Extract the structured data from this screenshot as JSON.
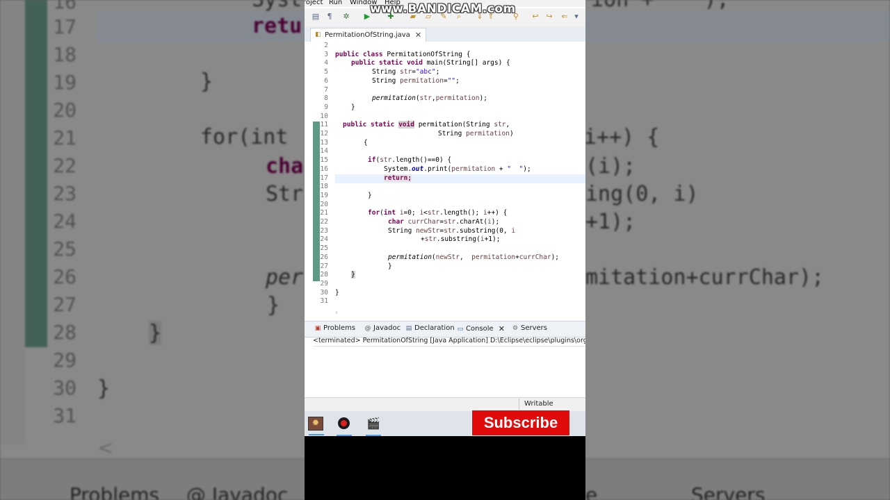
{
  "watermark": "www.BANDICAM.com",
  "menu": [
    "roject",
    "Run",
    "Window",
    "Help"
  ],
  "editor_tab": {
    "filename": "PermitationOfString.java"
  },
  "line_numbers": [
    "2",
    "3",
    "4",
    "5",
    "6",
    "7",
    "8",
    "9",
    "10",
    "11",
    "12",
    "13",
    "14",
    "15",
    "16",
    "17",
    "18",
    "19",
    "20",
    "21",
    "22",
    "23",
    "24",
    "25",
    "26",
    "27",
    "28",
    "29",
    "30",
    "31"
  ],
  "code": {
    "l3a": "public class",
    "l3b": " PermitationOfString {",
    "l4a": "public static void",
    "l4b": " main(String[] args) {",
    "l5a": "String ",
    "l5b": "str",
    "l5c": "=",
    "l5d": "\"abc\"",
    "l5e": ";",
    "l6a": "String ",
    "l6b": "permitation",
    "l6c": "=",
    "l6d": "\"\"",
    "l6e": ";",
    "l8a": "permitation",
    "l8b": "(",
    "l8c": "str",
    "l8d": ",",
    "l8e": "permitation",
    "l8f": ");",
    "l9": "}",
    "l11a": "public static ",
    "l11b": "void",
    "l11c": " permitation(String ",
    "l11d": "str",
    "l11e": ",",
    "l12a": "String ",
    "l12b": "permitation",
    "l12c": ")",
    "l13": "{",
    "l15a": "if",
    "l15b": "(",
    "l15c": "str",
    "l15d": ".length()==0) {",
    "l16a": "System.",
    "l16b": "out",
    "l16c": ".print(",
    "l16d": "permitation",
    "l16e": " + ",
    "l16f": "\"  \"",
    "l16g": ");",
    "l17": "return;",
    "l19": "}",
    "l21a": "for",
    "l21b": "(",
    "l21c": "int",
    "l21d": " ",
    "l21e": "i",
    "l21f": "=0; ",
    "l21g": "i",
    "l21h": "<",
    "l21i": "str",
    "l21j": ".length(); ",
    "l21k": "i",
    "l21l": "++) {",
    "l22a": "char",
    "l22b": " ",
    "l22c": "currChar",
    "l22d": "=",
    "l22e": "str",
    "l22f": ".charAt(",
    "l22g": "i",
    "l22h": ");",
    "l23a": "String ",
    "l23b": "newStr",
    "l23c": "=",
    "l23d": "str",
    "l23e": ".substring(0, ",
    "l23f": "i",
    "l24a": "+",
    "l24b": "str",
    "l24c": ".substring(",
    "l24d": "i",
    "l24e": "+1);",
    "l26a": "permitation",
    "l26b": "(",
    "l26c": "newStr",
    "l26d": ",  ",
    "l26e": "permitation",
    "l26f": "+",
    "l26g": "currChar",
    "l26h": ");",
    "l27": "}",
    "l28": "}",
    "l30": "}"
  },
  "panel_tabs": [
    "Problems",
    "Javadoc",
    "Declaration",
    "Console",
    "Servers"
  ],
  "console_status": "<terminated> PermitationOfString [Java Application] D:\\Eclipse\\eclipse\\plugins\\org.ecli",
  "status": {
    "writable": "Writable"
  },
  "subscribe": "Subscribe",
  "background": {
    "line_numbers": [
      "16",
      "17",
      "18",
      "19",
      "20",
      "21",
      "22",
      "23",
      "24",
      "25",
      "26",
      "27",
      "28",
      "29",
      "30",
      "31"
    ],
    "code": {
      "sys": "Syst",
      "sys_tail": "ion +   \");",
      "ret": "retu",
      "close19": "}",
      "for_text": "for(int",
      "for_tail": "i++) {",
      "cha": "cha",
      "cha_tail": "(i);",
      "str": "Str",
      "str_tail": "ing(0, i)",
      "plus_tail": "+1);",
      "per": "per",
      "per_tail": "mitation+currChar);",
      "close27": "}",
      "close28": "}",
      "close30": "}",
      "scroll_left": "<"
    },
    "tabs": {
      "problems": "Problems",
      "javadoc": "@ Javadoc",
      "e": "e",
      "servers": "Servers"
    }
  }
}
